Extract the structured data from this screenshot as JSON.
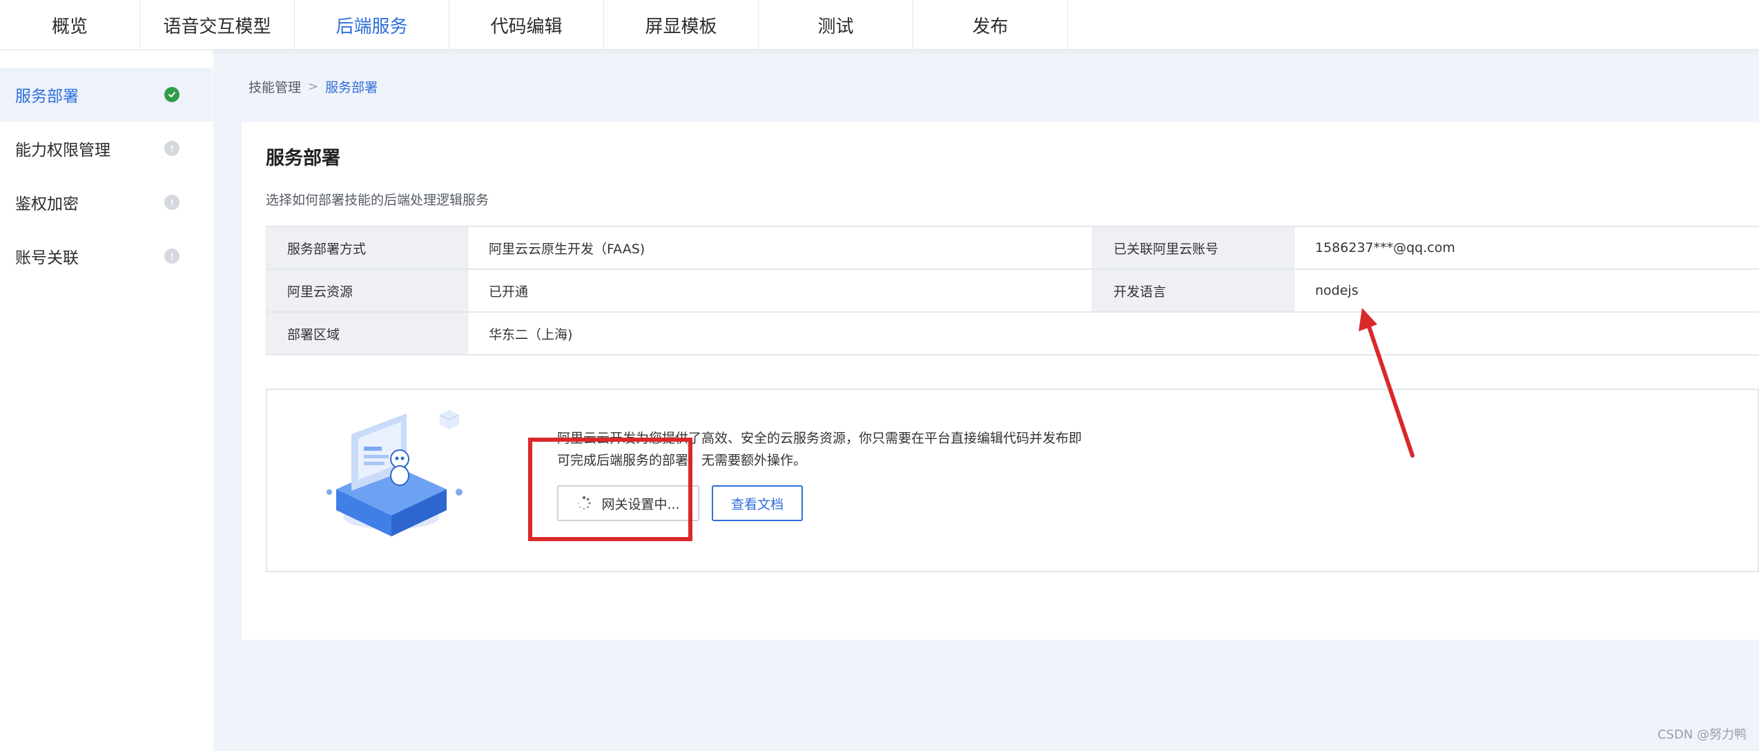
{
  "tabs": [
    {
      "label": "概览",
      "active": false
    },
    {
      "label": "语音交互模型",
      "active": false
    },
    {
      "label": "后端服务",
      "active": true
    },
    {
      "label": "代码编辑",
      "active": false
    },
    {
      "label": "屏显模板",
      "active": false
    },
    {
      "label": "测试",
      "active": false
    },
    {
      "label": "发布",
      "active": false
    }
  ],
  "sidebar": {
    "items": [
      {
        "label": "服务部署",
        "status": "complete",
        "icon": "check-circle-icon"
      },
      {
        "label": "能力权限管理",
        "status": "info",
        "icon": "info-circle-icon"
      },
      {
        "label": "鉴权加密",
        "status": "info",
        "icon": "info-circle-icon"
      },
      {
        "label": "账号关联",
        "status": "info",
        "icon": "info-circle-icon"
      }
    ]
  },
  "breadcrumb": {
    "parent": "技能管理",
    "separator": ">",
    "current": "服务部署"
  },
  "card": {
    "title": "服务部署",
    "description": "选择如何部署技能的后端处理逻辑服务"
  },
  "info_table": {
    "deploy_method_label": "服务部署方式",
    "deploy_method_value": "阿里云云原生开发（FAAS)",
    "linked_account_label": "已关联阿里云账号",
    "linked_account_value": "1586237***@qq.com",
    "resource_label": "阿里云资源",
    "resource_value": "已开通",
    "language_label": "开发语言",
    "language_value": "nodejs",
    "region_label": "部署区域",
    "region_value": "华东二（上海)"
  },
  "promo": {
    "text": "阿里云云开发为您提供了高效、安全的云服务资源，你只需要在平台直接编辑代码并发布即可完成后端服务的部署，无需要额外操作。",
    "gateway_button": "网关设置中...",
    "docs_button": "查看文档"
  },
  "watermark": "CSDN @努力鸭",
  "colors": {
    "accent": "#2e6fdc",
    "success": "#2f9d49",
    "annotation": "#d9292b",
    "page_bg": "#f0f3f9"
  }
}
